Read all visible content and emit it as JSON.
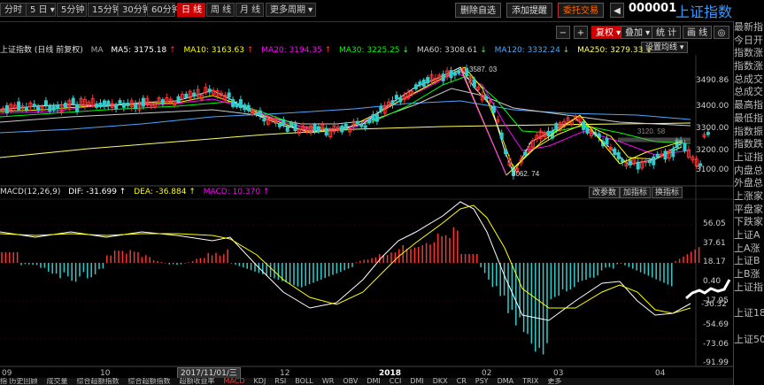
{
  "toolbar": {
    "timeframes": [
      {
        "label": "分时",
        "active": false
      },
      {
        "label": "5 日 ▾",
        "active": false
      },
      {
        "label": "5分钟",
        "active": false
      },
      {
        "label": "15分钟",
        "active": false
      },
      {
        "label": "30分钟",
        "active": false
      },
      {
        "label": "60分钟",
        "active": false
      },
      {
        "label": "日 线",
        "active": true
      },
      {
        "label": "周 线",
        "active": false
      },
      {
        "label": "月 线",
        "active": false
      },
      {
        "label": "更多周期 ▾",
        "active": false
      }
    ],
    "delete_watch": "删除自选",
    "add_alert": "添加提醒",
    "trade": "委托交易",
    "code": "000001",
    "index_name": "上证指数",
    "nav_prev": "◀",
    "nav_next": "▶"
  },
  "chart_tools": {
    "minus": "−",
    "plus": "+",
    "fuquan": "复权 ▾",
    "overlay": "叠加 ▾",
    "stats": "统 计",
    "draw": "画 线",
    "other": "◎",
    "settings": "设置均线 ▾"
  },
  "legend": {
    "title": "上证指数 (日线 前复权)",
    "ma": [
      {
        "label": "MA5: 3175.18",
        "color": "#ffffff"
      },
      {
        "label": "MA10: 3163.63",
        "color": "#ffff00"
      },
      {
        "label": "MA20: 3194.35",
        "color": "#ff00ff"
      },
      {
        "label": "MA30: 3225.25",
        "color": "#00ff00"
      },
      {
        "label": "MA60: 3308.61",
        "color": "#cccccc"
      },
      {
        "label": "MA120: 3332.24",
        "color": "#4aa8ff"
      },
      {
        "label": "MA250: 3279.33",
        "color": "#ffff66"
      }
    ],
    "arrows": [
      "↑",
      "↑",
      "↑",
      "↓",
      "↓",
      "↓",
      "↓"
    ]
  },
  "price_axis": [
    "3490.86",
    "3400.00",
    "3300.00",
    "3200.00",
    "3100.00"
  ],
  "price_annotations": {
    "high": "3587. 03",
    "low": "3062. 74",
    "mid": "3120. 58"
  },
  "macd": {
    "title": "MACD(12,26,9)",
    "dif": "DIF: -31.699 ↑",
    "dea": "DEA: -36.884 ↑",
    "macd": "MACD: 10.370 ↑",
    "buttons": [
      "改参数",
      "加指标",
      "换指标"
    ],
    "axis": [
      "56.05",
      "37.61",
      "18.17",
      "0.40",
      "-17.95",
      "-36.32",
      "-54.69",
      "-73.06",
      "-91.99"
    ]
  },
  "x_axis": [
    "09",
    "10",
    "2017/11/01/三",
    "12",
    "2018",
    "02",
    "03",
    "04"
  ],
  "bottom_tabs": [
    "指 历史回顾",
    "成交量",
    "综合超额指数",
    "综合超额指数",
    "超额收益率",
    "MACD",
    "KDJ",
    "RSI",
    "BOLL",
    "WR",
    "OBV",
    "DMI",
    "CCI",
    "DMI",
    "DKX",
    "CR",
    "PSY",
    "DMA",
    "TRIX",
    "更多"
  ],
  "bottom_tab_selected": 5,
  "right_panel": [
    "最新指",
    "今日开",
    "指数涨",
    "指数涨",
    "总成交",
    "总成交",
    "最高指",
    "最低指",
    "指数振",
    "指数跌",
    "上证指",
    "内盘总",
    "外盘总",
    "上涨家",
    "平盘家",
    "下跌家",
    "上证A",
    "上A涨",
    "上证B",
    "上B涨",
    "上证指",
    "",
    "上证18",
    "",
    "上证50"
  ],
  "colors": {
    "up": "#ff3333",
    "down": "#33cccc",
    "accent": "#cc0000",
    "index_name": "#3399ff"
  }
}
